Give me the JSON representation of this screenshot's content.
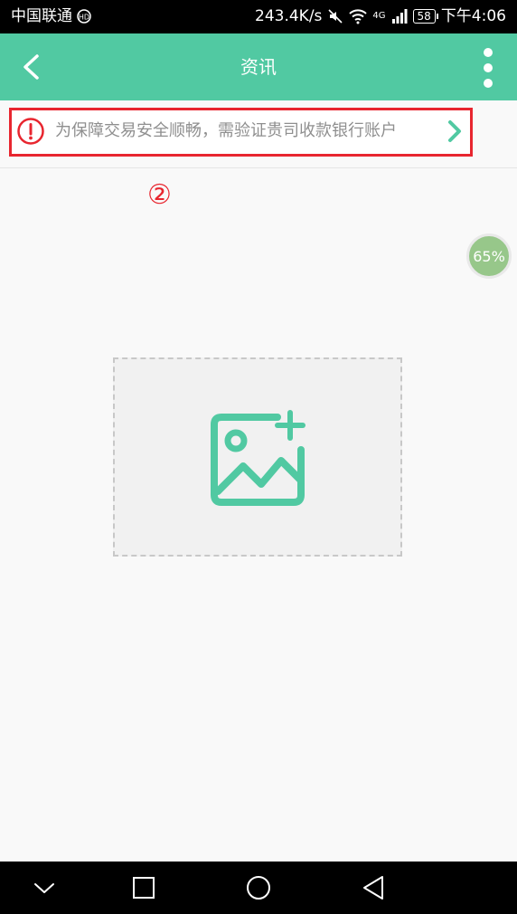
{
  "status_bar": {
    "carrier": "中国联通",
    "net_speed": "243.4K/s",
    "network_type": "4G",
    "battery": "58",
    "time": "下午4:06"
  },
  "app_bar": {
    "title": "资讯",
    "back_icon": "chevron-left-icon",
    "menu_icon": "more-vertical-icon"
  },
  "notice": {
    "text": "为保障交易安全顺畅，需验证贵司收款银行账户",
    "icon": "alert-circle-icon",
    "arrow_icon": "chevron-right-icon"
  },
  "marker_label": "②",
  "progress": {
    "value": 65,
    "label": "65%"
  },
  "placeholder": {
    "icon": "add-image-icon"
  },
  "colors": {
    "brand": "#51c9a2",
    "alert": "#e8262f",
    "progress": "#97c78a"
  }
}
